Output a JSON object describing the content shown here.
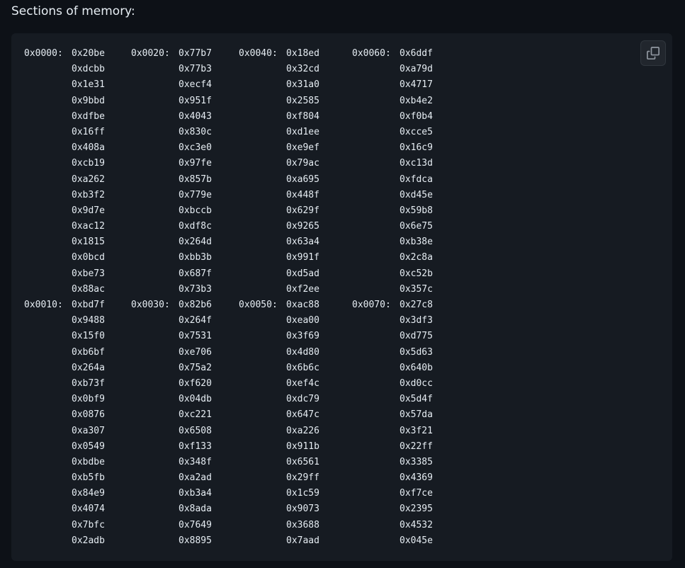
{
  "heading": "Sections of memory:",
  "copy_button": {
    "icon": "copy-icon"
  },
  "columns": [
    {
      "sections": [
        {
          "address": "0x0000:",
          "values": [
            "0x20be",
            "0xdcbb",
            "0x1e31",
            "0x9bbd",
            "0xdfbe",
            "0x16ff",
            "0x408a",
            "0xcb19",
            "0xa262",
            "0xb3f2",
            "0x9d7e",
            "0xac12",
            "0x1815",
            "0x0bcd",
            "0xbe73",
            "0x88ac"
          ]
        },
        {
          "address": "0x0010:",
          "values": [
            "0xbd7f",
            "0x9488",
            "0x15f0",
            "0xb6bf",
            "0x264a",
            "0xb73f",
            "0x0bf9",
            "0x0876",
            "0xa307",
            "0x0549",
            "0xbdbe",
            "0xb5fb",
            "0x84e9",
            "0x4074",
            "0x7bfc",
            "0x2adb"
          ]
        }
      ]
    },
    {
      "sections": [
        {
          "address": "0x0020:",
          "values": [
            "0x77b7",
            "0x77b3",
            "0xecf4",
            "0x951f",
            "0x4043",
            "0x830c",
            "0xc3e0",
            "0x97fe",
            "0x857b",
            "0x779e",
            "0xbccb",
            "0xdf8c",
            "0x264d",
            "0xbb3b",
            "0x687f",
            "0x73b3"
          ]
        },
        {
          "address": "0x0030:",
          "values": [
            "0x82b6",
            "0x264f",
            "0x7531",
            "0xe706",
            "0x75a2",
            "0xf620",
            "0x04db",
            "0xc221",
            "0x6508",
            "0xf133",
            "0x348f",
            "0xa2ad",
            "0xb3a4",
            "0x8ada",
            "0x7649",
            "0x8895"
          ]
        }
      ]
    },
    {
      "sections": [
        {
          "address": "0x0040:",
          "values": [
            "0x18ed",
            "0x32cd",
            "0x31a0",
            "0x2585",
            "0xf804",
            "0xd1ee",
            "0xe9ef",
            "0x79ac",
            "0xa695",
            "0x448f",
            "0x629f",
            "0x9265",
            "0x63a4",
            "0x991f",
            "0xd5ad",
            "0xf2ee"
          ]
        },
        {
          "address": "0x0050:",
          "values": [
            "0xac88",
            "0xea00",
            "0x3f69",
            "0x4d80",
            "0x6b6c",
            "0xef4c",
            "0xdc79",
            "0x647c",
            "0xa226",
            "0x911b",
            "0x6561",
            "0x29ff",
            "0x1c59",
            "0x9073",
            "0x3688",
            "0x7aad"
          ]
        }
      ]
    },
    {
      "sections": [
        {
          "address": "0x0060:",
          "values": [
            "0x6ddf",
            "0xa79d",
            "0x4717",
            "0xb4e2",
            "0xf0b4",
            "0xcce5",
            "0x16c9",
            "0xc13d",
            "0xfdca",
            "0xd45e",
            "0x59b8",
            "0x6e75",
            "0xb38e",
            "0x2c8a",
            "0xc52b",
            "0x357c"
          ]
        },
        {
          "address": "0x0070:",
          "values": [
            "0x27c8",
            "0x3df3",
            "0xd775",
            "0x5d63",
            "0x640b",
            "0xd0cc",
            "0x5d4f",
            "0x57da",
            "0x3f21",
            "0x22ff",
            "0x3385",
            "0x4369",
            "0xf7ce",
            "0x2395",
            "0x4532",
            "0x045e"
          ]
        }
      ]
    }
  ]
}
